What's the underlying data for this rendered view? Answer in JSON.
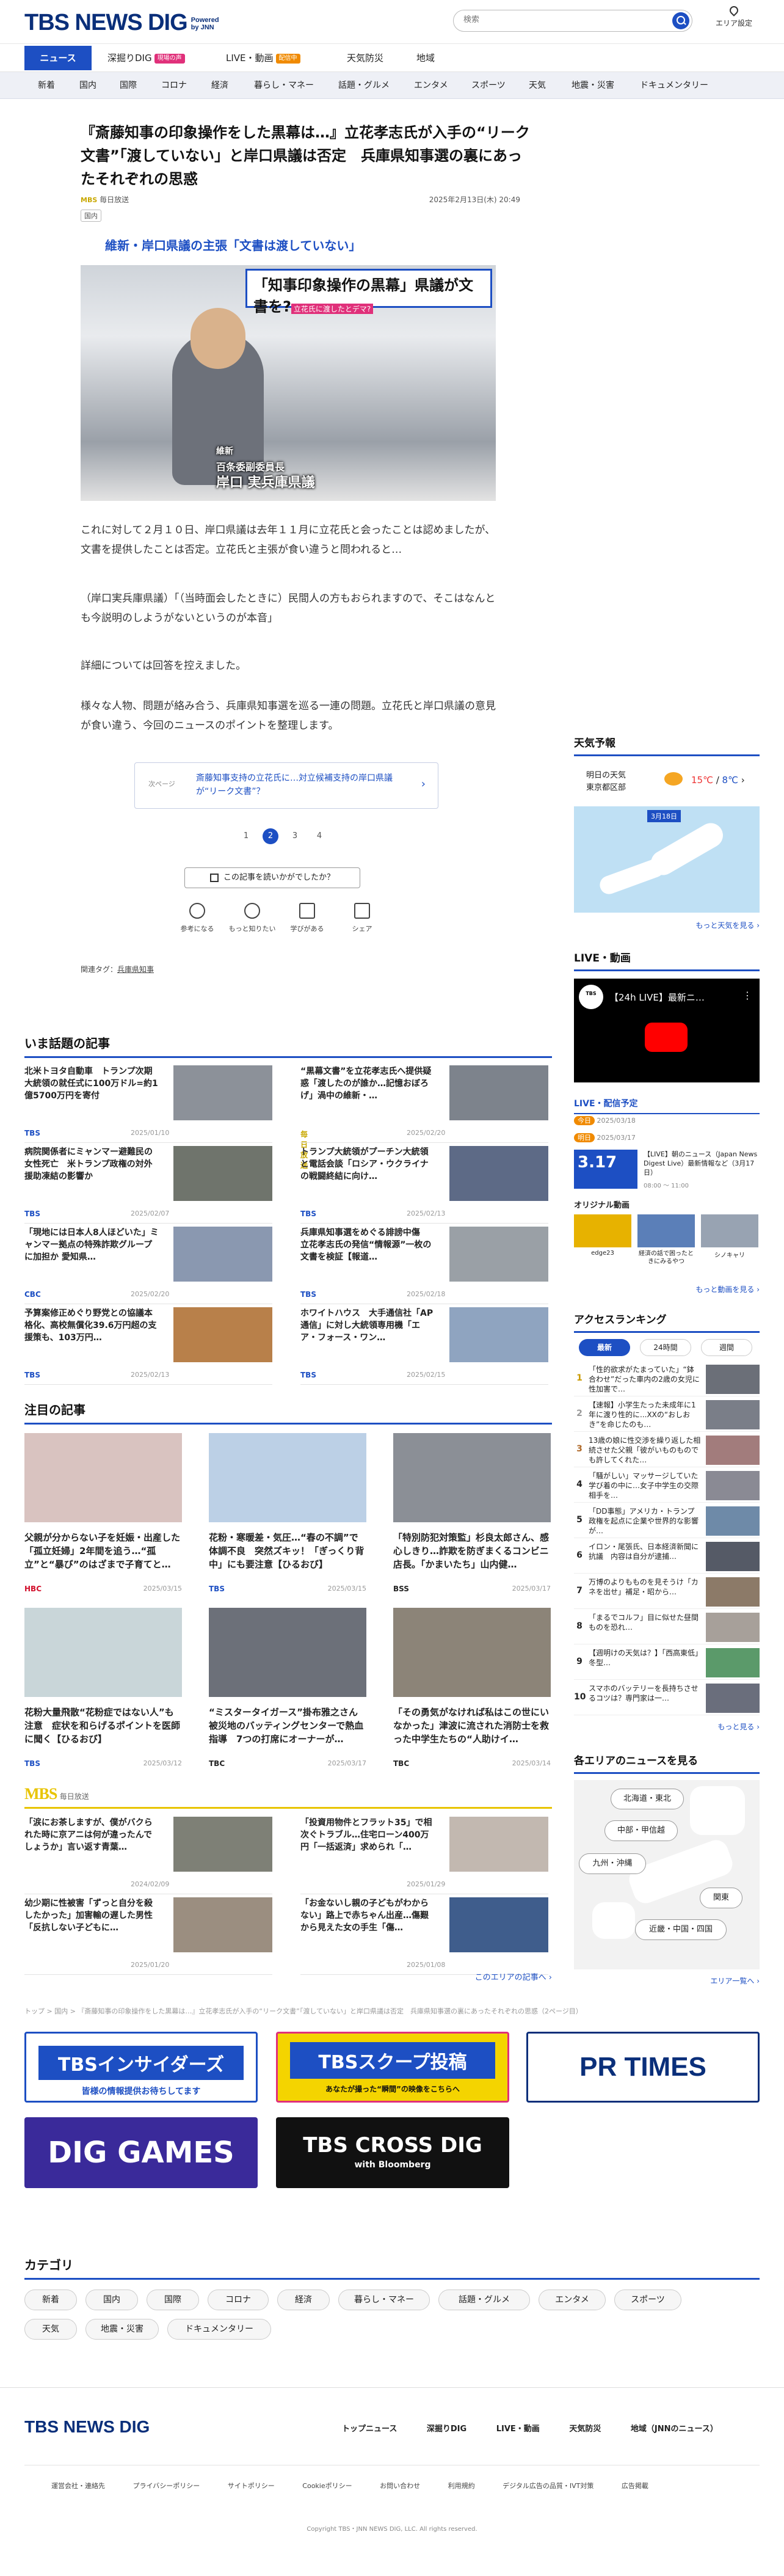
{
  "header": {
    "logo": "TBS NEWS DIG",
    "powered": "Powered",
    "by": "by JNN",
    "search_placeholder": "検索",
    "area_label": "エリア設定"
  },
  "gnav": [
    {
      "label": "ニュース"
    },
    {
      "label": "深掘りDIG",
      "badge": "現場の声",
      "badge_color": "#e0307a"
    },
    {
      "label": "LIVE・動画",
      "badge": "配信中",
      "badge_color": "#f08a00"
    },
    {
      "label": "天気防災"
    },
    {
      "label": "地域"
    }
  ],
  "subnav": [
    "新着",
    "国内",
    "国際",
    "コロナ",
    "経済",
    "暮らし・マネー",
    "話題・グルメ",
    "エンタメ",
    "スポーツ",
    "天気",
    "地震・災害",
    "ドキュメンタリー"
  ],
  "article": {
    "title": "『斎藤知事の印象操作をした黒幕は…』立花孝志氏が入手の“リーク文書”「渡していない」と岸口県議は否定　兵庫県知事選の裏にあったそれぞれの思惑",
    "source": "毎日放送",
    "source_tag": "MBS",
    "date": "2025年2月13日(木) 20:49",
    "category": "国内",
    "lead": "維新・岸口県議の主張「文書は渡していない」",
    "hero_caption_top": "「知事印象操作の黒幕」県議が文書を?",
    "hero_caption_sub": "立花氏に渡したとデマ?",
    "hero_name_title": "維新",
    "hero_name_role": "百条委副委員長",
    "hero_name": "岸口 実兵庫県議",
    "p1": "これに対して２月１０日、岸口県議は去年１１月に立花氏と会ったことは認めましたが、文書を提供したことは否定。立花氏と主張が食い違うと問われると…",
    "p2": "（岸口実兵庫県議）「（当時面会したときに）民間人の方もおられますので、そこはなんとも今説明のしようがないというのが本音」",
    "p3": "詳細については回答を控えました。",
    "p4": "様々な人物、問題が絡み合う、兵庫県知事選を巡る一連の問題。立花氏と岸口県議の意見が食い違う、今回のニュースのポイントを整理します。",
    "next_label": "次ページ",
    "next_text": "斎藤知事支持の立花氏に…対立候補支持の岸口県議が“リーク文書”？",
    "pages": [
      "1",
      "2",
      "3",
      "4"
    ],
    "current_page": "2",
    "feedback_label": "この記事を読いかがでしたか？",
    "reactions": [
      "参考になる",
      "もっと知りたい",
      "学びがある",
      "シェア"
    ],
    "tags_label": "関連タグ：",
    "tag": "兵庫県知事"
  },
  "trending": {
    "title": "いま話題の記事",
    "items": [
      {
        "title": "北米トヨタ自動車　トランプ次期大統領の就任式に100万ドル=約1億5700万円を寄付",
        "src": "TBS",
        "date": "2025/01/10"
      },
      {
        "title": "“黒幕文書”を立花孝志氏へ提供疑惑「渡したのが誰か…記憶おぼろげ」渦中の維新・…",
        "src": "毎日放送",
        "date": "2025/02/20"
      },
      {
        "title": "病院関係者にミャンマー避難民の女性死亡　米トランプ政権の対外援助凍結の影響か",
        "src": "TBS",
        "date": "2025/02/07"
      },
      {
        "title": "トランプ大統領がプーチン大統領と電話会談「ロシア・ウクライナの戦闘終結に向け…",
        "src": "TBS",
        "date": "2025/02/13"
      },
      {
        "title": "「現地には日本人8人ほどいた」ミャンマー拠点の特殊詐欺グループに加担か 愛知県…",
        "src": "CBC",
        "date": "2025/02/20"
      },
      {
        "title": "兵庫県知事選をめぐる誹謗中傷　立花孝志氏の発信“情報源”一枚の文書を検証【報道…",
        "src": "TBS",
        "date": "2025/02/18"
      },
      {
        "title": "予算案修正めぐり野党との協議本格化、高校無償化39.6万円超の支援策も、103万円…",
        "src": "TBS",
        "date": "2025/02/13"
      },
      {
        "title": "ホワイトハウス　大手通信社「AP通信」に対し大統領専用機「エア・フォース・ワン…",
        "src": "TBS",
        "date": "2025/02/15"
      }
    ]
  },
  "featured": {
    "title": "注目の記事",
    "items": [
      {
        "title": "父親が分からない子を妊娠・出産した「孤立妊婦」2年間を追う…“孤立”と“暴び”のはざまで子育てと…",
        "src": "HBC",
        "date": "2025/03/15"
      },
      {
        "title": "花粉・寒暖差・気圧…“春の不調”で体調不良　突然ズキッ！「ぎっくり背中」にも要注意【ひるおび】",
        "src": "TBS",
        "date": "2025/03/15"
      },
      {
        "title": "「特別防犯対策監」杉良太郎さん、感心しきり…詐欺を防ぎまくるコンビニ店長。「かまいたち」山内健…",
        "src": "BSS",
        "date": "2025/03/17"
      },
      {
        "title": "花粉大量飛散“花粉症ではない人”も注意　症状を和らげるポイントを医師に聞く【ひるおび】",
        "src": "TBS",
        "date": "2025/03/12"
      },
      {
        "title": "“ミスタータイガース”掛布雅之さん　被災地のバッティングセンターで熱血指導　7つの打席にオーナーが…",
        "src": "TBC",
        "date": "2025/03/17"
      },
      {
        "title": "「その勇気がなければ私はこの世にいなかった」津波に流された消防士を救った中学生たちの“人助けイ…",
        "src": "TBC",
        "date": "2025/03/14"
      }
    ]
  },
  "mbs": {
    "logo": "MBS",
    "label": "毎日放送",
    "items": [
      {
        "title": "「涙にお茶しますが、僕がバクられた時に京アニは何が違ったんでしょうか」言い返す青葉…",
        "date": "2024/02/09"
      },
      {
        "title": "「投資用物件とフラット35」で相次ぐトラブル…住宅ローン400万円「一括返済」求められ「…",
        "date": "2025/01/29"
      },
      {
        "title": "幼少期に性被害「ずっと自分を殺したかった」加害輸の遅した男性「反抗しない子どもに…",
        "date": "2025/01/20"
      },
      {
        "title": "「お金ないし親の子どもがわからない」路上で赤ちゃん出産…傷艱から見えた女の手生「傷…",
        "date": "2025/01/08"
      }
    ],
    "more": "このエリアの記事へ"
  },
  "breadcrumb": "トップ > 国内 > 『斎藤知事の印象操作をした黒幕は…』立花孝志氏が入手の“リーク文書”「渡していない」と岸口県議は否定　兵庫県知事選の裏にあったそれぞれの思惑（2ページ目）",
  "banners": [
    {
      "title": "TBSインサイダーズ",
      "sub": "皆様の情報提供お待ちしてます"
    },
    {
      "title": "TBSスクープ投稿",
      "sub": "あなたが撮った“瞬間”の映像をこちらへ"
    },
    {
      "title": "PR TIMES"
    },
    {
      "title": "DIG GAMES"
    },
    {
      "title": "TBS CROSS DIG",
      "sub": "with Bloomberg"
    }
  ],
  "categories": {
    "title": "カテゴリ",
    "items": [
      "新着",
      "国内",
      "国際",
      "コロナ",
      "経済",
      "暮らし・マネー",
      "話題・グルメ",
      "エンタメ",
      "スポーツ",
      "天気",
      "地震・災害",
      "ドキュメンタリー"
    ]
  },
  "sidebar": {
    "weather_title": "天気予報",
    "weather_day": "明日の天気",
    "weather_place": "東京都区部",
    "weather_hi": "15℃",
    "weather_lo": "8℃",
    "weather_map_label": "3月18日",
    "weather_more": "もっと天気を見る",
    "live_title": "LIVE・動画",
    "live_video_title": "【24h LIVE】最新ニ…",
    "schedule_title": "LIVE・配信予定",
    "schedule_items": [
      {
        "tag": "今日",
        "date": "2025/03/18"
      },
      {
        "tag": "明日",
        "date": "2025/03/17"
      }
    ],
    "live_item_date": "3.17",
    "live_item_title": "【LIVE】朝のニュース（Japan News Digest Live）最新情報など（3月17日）",
    "live_item_time": "08:00 ～ 11:00",
    "original_title": "オリジナル動画",
    "original_items": [
      "edge23",
      "経済の話で困ったときにみるやつ",
      "シノキャリ"
    ],
    "video_more": "もっと動画を見る",
    "ranking_title": "アクセスランキング",
    "ranking_tabs": [
      "最新",
      "24時間",
      "週間"
    ],
    "ranking_items": [
      "「性的欲求がたまっていた」“鉢合わせ”だった車内の2歳の女児に性加害で…",
      "【速報】小学生たった未成年に1年に渡り性的に...XXの“おしおき”を命じたのも…",
      "13歳の娘に性交渉を繰り返した相続させた父親「彼がいものものでも許してくれた…",
      "「騒がしい」マッサージしていた学び着の中に…女子中学生の交際相手を…",
      "「DD事態」アメリカ・トランプ政権を起点に企業や世界的な影響が…",
      "イロン・尾張氏、日本経済新聞に抗議　内容は自分が逮捕…",
      "万博のよりもものを見そうけ「カネを出せ」補足・昭から…",
      "「まるでコルフ」目に似せた昼間ものを恐れ…",
      "【週明けの天気は？】「西高東低」冬型…",
      "スマホのバッテリーを長持ちさせるコツは？専門家は一…"
    ],
    "ranking_more": "もっと見る",
    "area_title": "各エリアのニュースを見る",
    "area_items": [
      "北海道・東北",
      "中部・甲信越",
      "九州・沖縄",
      "関東",
      "近畿・中国・四国"
    ],
    "area_more": "エリア一覧へ"
  },
  "footer": {
    "nav": [
      "トップニュース",
      "深掘りDIG",
      "LIVE・動画",
      "天気防災",
      "地域（JNNのニュース）"
    ],
    "links": [
      "運営会社・連絡先",
      "プライバシーポリシー",
      "サイトポリシー",
      "Cookieポリシー",
      "お問い合わせ",
      "利用規約",
      "デジタル広告の品質・IVT対策",
      "広告掲載"
    ],
    "copyright": "Copyright TBS・JNN NEWS DIG, LLC. All rights reserved."
  },
  "colors": {
    "brand": "#0a2f7a",
    "accent": "#1d4fc3",
    "mbs": "#e8c400",
    "tbs_src": "#1d4fc3"
  }
}
